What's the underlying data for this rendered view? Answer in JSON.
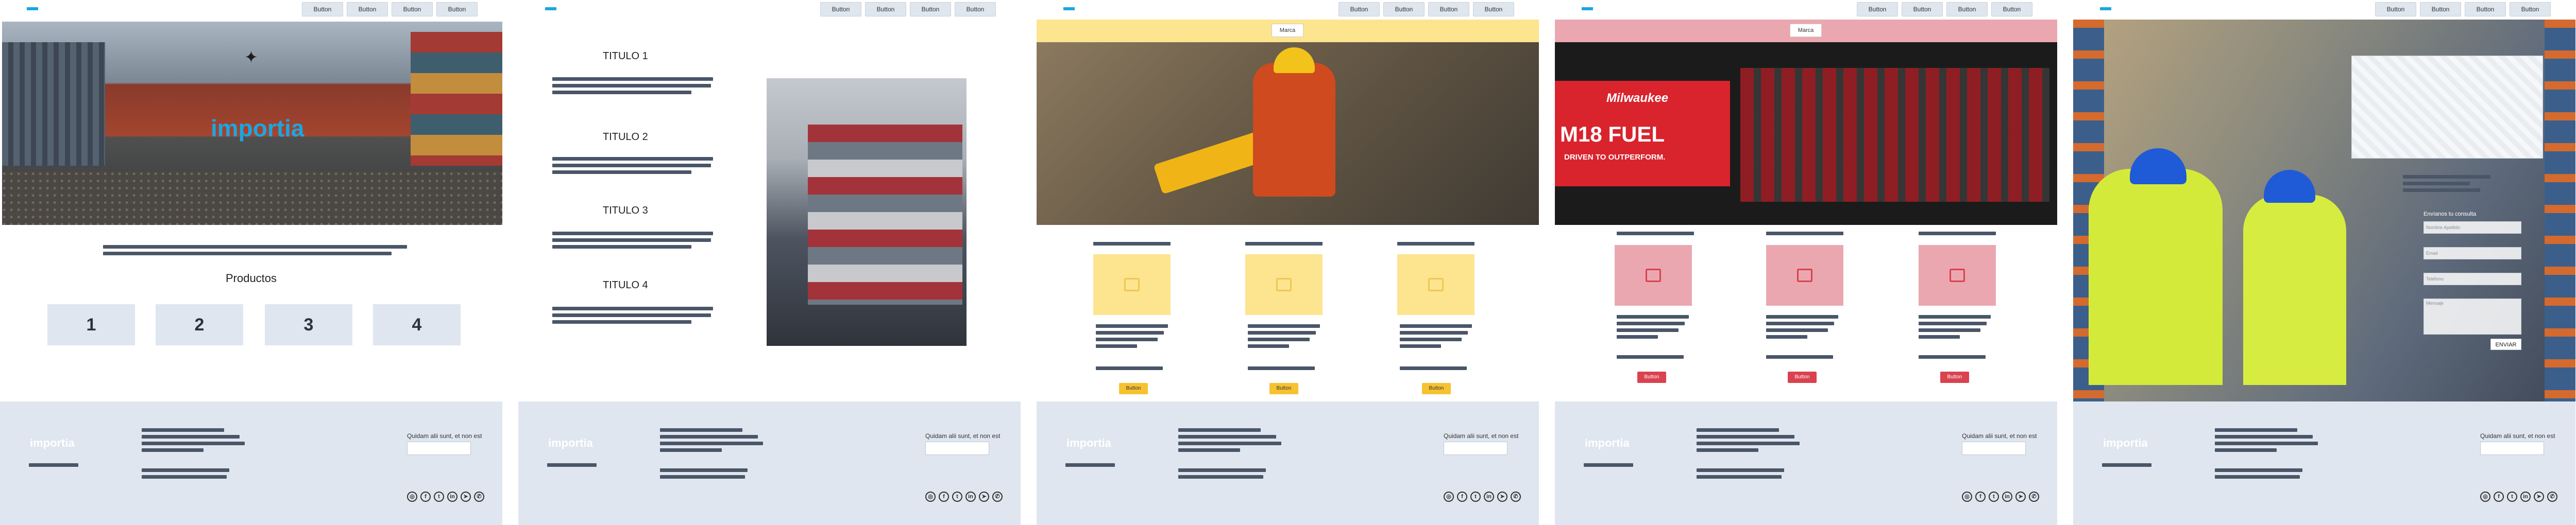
{
  "topbar": {
    "buttons": [
      "Button",
      "Button",
      "Button",
      "Button"
    ]
  },
  "footer": {
    "logo_text": "importia",
    "subscribe_label": "Quidam alii sunt, et non est",
    "social_icons": [
      "instagram-icon",
      "facebook-icon",
      "twitter-icon",
      "linkedin-icon",
      "telegram-icon",
      "whatsapp-icon"
    ]
  },
  "panel0": {
    "hero_logo": "importia",
    "section_title": "Productos",
    "cards": [
      "1",
      "2",
      "3",
      "4"
    ]
  },
  "panel1": {
    "titles": [
      "TITULO 1",
      "TITULO 2",
      "TITULO 3",
      "TITULO 4"
    ]
  },
  "panel2": {
    "brand_button": "Marca",
    "card_button": "Button"
  },
  "panel3": {
    "brand_button": "Marca",
    "card_button": "Button",
    "hero_brand": "Milwaukee",
    "hero_headline": "M18 FUEL",
    "hero_tagline": "DRIVEN TO OUTPERFORM."
  },
  "panel4": {
    "form_title": "Envíanos tu consulta",
    "field_1": "Nombre Apellido",
    "field_2": "Email",
    "field_3": "Teléfono",
    "message": "Mensaje",
    "send_button": "ENVIAR"
  }
}
